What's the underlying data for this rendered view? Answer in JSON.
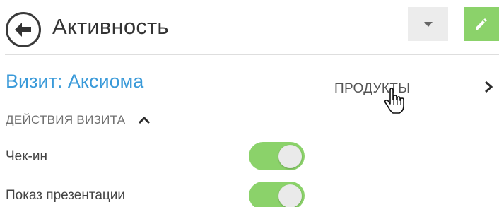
{
  "header": {
    "title": "Активность"
  },
  "record": {
    "title": "Визит: Аксиома",
    "products_link": "ПРОДУКТЫ"
  },
  "section": {
    "label": "ДЕЙСТВИЯ ВИЗИТА",
    "expanded": true
  },
  "actions": [
    {
      "label": "Чек-ин",
      "enabled": true
    },
    {
      "label": "Показ презентации",
      "enabled": true
    }
  ],
  "colors": {
    "accent_green": "#8bd26a",
    "title_blue": "#3a9ad9",
    "dropdown_bg": "#ececec"
  },
  "icons": [
    "back-arrow-icon",
    "caret-down-icon",
    "pencil-icon",
    "chevron-right-icon",
    "chevron-up-icon",
    "hand-cursor-icon"
  ]
}
